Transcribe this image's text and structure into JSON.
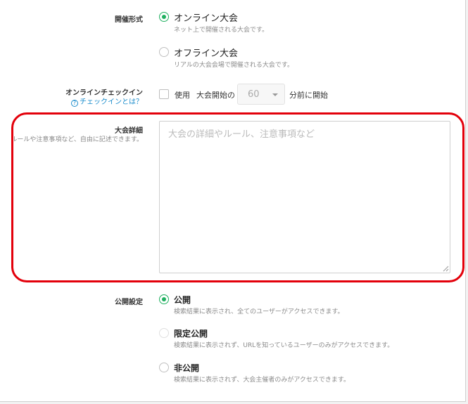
{
  "format": {
    "label": "開催形式",
    "options": [
      {
        "label": "オンライン大会",
        "desc": "ネット上で開催される大会です。",
        "selected": true
      },
      {
        "label": "オフライン大会",
        "desc": "リアルの大会会場で開催される大会です。",
        "selected": false
      }
    ]
  },
  "checkin": {
    "label": "オンラインチェックイン",
    "help_label": "チェックインとは？",
    "help_icon": "?",
    "use_label": "使用",
    "before_label": "大会開始の",
    "minutes_value": "60",
    "after_label": "分前に開始",
    "checked": false
  },
  "details": {
    "label": "大会詳細",
    "sublabel": "ルールや注意事項など、自由に記述できます。",
    "placeholder": "大会の詳細やルール、注意事項など",
    "value": ""
  },
  "visibility": {
    "label": "公開設定",
    "options": [
      {
        "label": "公開",
        "desc": "検索結果に表示され、全てのユーザーがアクセスできます。",
        "selected": true
      },
      {
        "label": "限定公開",
        "desc": "検索結果に表示されず、URLを知っているユーザーのみがアクセスできます。",
        "selected": false
      },
      {
        "label": "非公開",
        "desc": "検索結果に表示されず、大会主催者のみがアクセスできます。",
        "selected": false
      }
    ]
  },
  "colors": {
    "accent": "#20b060",
    "link": "#1a8ccc",
    "highlight": "#e3000b"
  }
}
